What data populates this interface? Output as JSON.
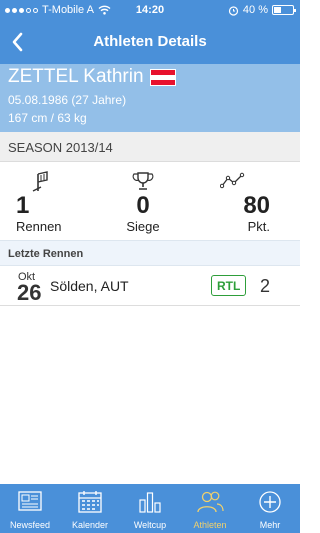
{
  "status_bar": {
    "carrier": "T-Mobile A",
    "time": "14:20",
    "battery_text": "40 %",
    "battery_level": 0.4
  },
  "navbar": {
    "title": "Athleten Details",
    "back_icon": "chevron-left-icon"
  },
  "athlete": {
    "name": "ZETTEL Kathrin",
    "flag": "austria-flag",
    "flag_colors": [
      "#e8112d",
      "#ffffff",
      "#e8112d"
    ],
    "birthdate": "05.08.1986 (27 Jahre)",
    "body": "167 cm / 63 kg"
  },
  "season": {
    "label": "SEASON 2013/14"
  },
  "stats": [
    {
      "icon": "gate-icon",
      "value": "1",
      "label": "Rennen"
    },
    {
      "icon": "trophy-icon",
      "value": "0",
      "label": "Siege"
    },
    {
      "icon": "trend-icon",
      "value": "80",
      "label": "Pkt."
    }
  ],
  "recent_races": {
    "header": "Letzte Rennen",
    "items": [
      {
        "month": "Okt",
        "day": "26",
        "location": "Sölden, AUT",
        "discipline": "RTL",
        "place": "2"
      }
    ]
  },
  "tabbar": {
    "tabs": [
      {
        "label": "Newsfeed",
        "icon": "newspaper-icon"
      },
      {
        "label": "Kalender",
        "icon": "calendar-icon"
      },
      {
        "label": "Weltcup",
        "icon": "bar-chart-icon"
      },
      {
        "label": "Athleten",
        "icon": "athletes-icon",
        "active": true
      },
      {
        "label": "Mehr",
        "icon": "plus-circle-icon"
      }
    ],
    "active_color": "#f2d16b"
  },
  "colors": {
    "primary": "#4a90d9",
    "athlete_bg": "#93bfe8",
    "discipline_green": "#2e9e3a"
  }
}
